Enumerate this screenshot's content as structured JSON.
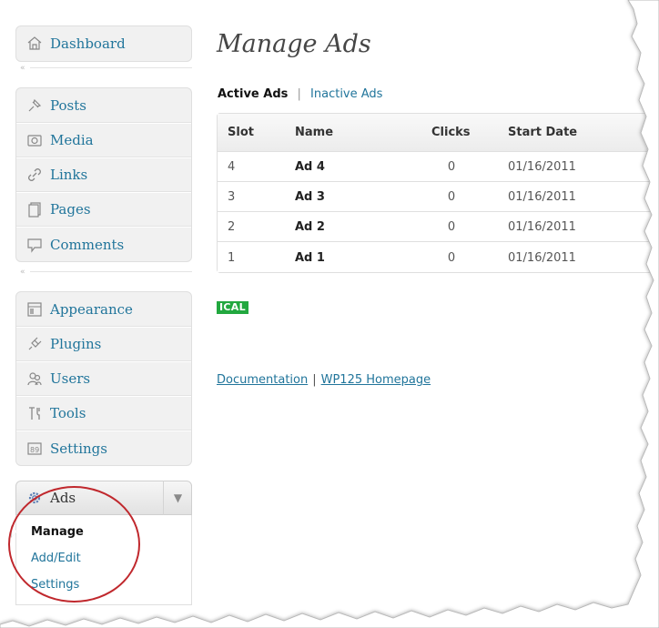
{
  "sidebar": {
    "dashboard": {
      "label": "Dashboard",
      "icon": "dashboard-icon"
    },
    "content_items": [
      {
        "label": "Posts",
        "icon": "pin-icon"
      },
      {
        "label": "Media",
        "icon": "media-icon"
      },
      {
        "label": "Links",
        "icon": "link-icon"
      },
      {
        "label": "Pages",
        "icon": "pages-icon"
      },
      {
        "label": "Comments",
        "icon": "comment-icon"
      }
    ],
    "admin_items": [
      {
        "label": "Appearance",
        "icon": "appearance-icon"
      },
      {
        "label": "Plugins",
        "icon": "plugin-icon"
      },
      {
        "label": "Users",
        "icon": "users-icon"
      },
      {
        "label": "Tools",
        "icon": "tools-icon"
      },
      {
        "label": "Settings",
        "icon": "settings-icon"
      }
    ],
    "ads_menu": {
      "label": "Ads",
      "icon": "gear-icon",
      "submenu": [
        {
          "label": "Manage",
          "current": true
        },
        {
          "label": "Add/Edit",
          "current": false
        },
        {
          "label": "Settings",
          "current": false
        }
      ]
    }
  },
  "main": {
    "title": "Manage Ads",
    "filters": {
      "active": "Active Ads",
      "separator": "|",
      "inactive": "Inactive Ads"
    },
    "table": {
      "columns": [
        "Slot",
        "Name",
        "Clicks",
        "Start Date"
      ],
      "rows": [
        {
          "slot": "4",
          "name": "Ad 4",
          "clicks": "0",
          "start_date": "01/16/2011"
        },
        {
          "slot": "3",
          "name": "Ad 3",
          "clicks": "0",
          "start_date": "01/16/2011"
        },
        {
          "slot": "2",
          "name": "Ad 2",
          "clicks": "0",
          "start_date": "01/16/2011"
        },
        {
          "slot": "1",
          "name": "Ad 1",
          "clicks": "0",
          "start_date": "01/16/2011"
        }
      ]
    },
    "ical_badge": "ICAL",
    "footer": {
      "documentation": "Documentation",
      "separator": "|",
      "homepage": "WP125 Homepage"
    }
  },
  "colors": {
    "link": "#21759b",
    "ical_badge": "#22a83f",
    "highlight_circle": "#c0282d",
    "menu_background": "#f1f1f1"
  }
}
